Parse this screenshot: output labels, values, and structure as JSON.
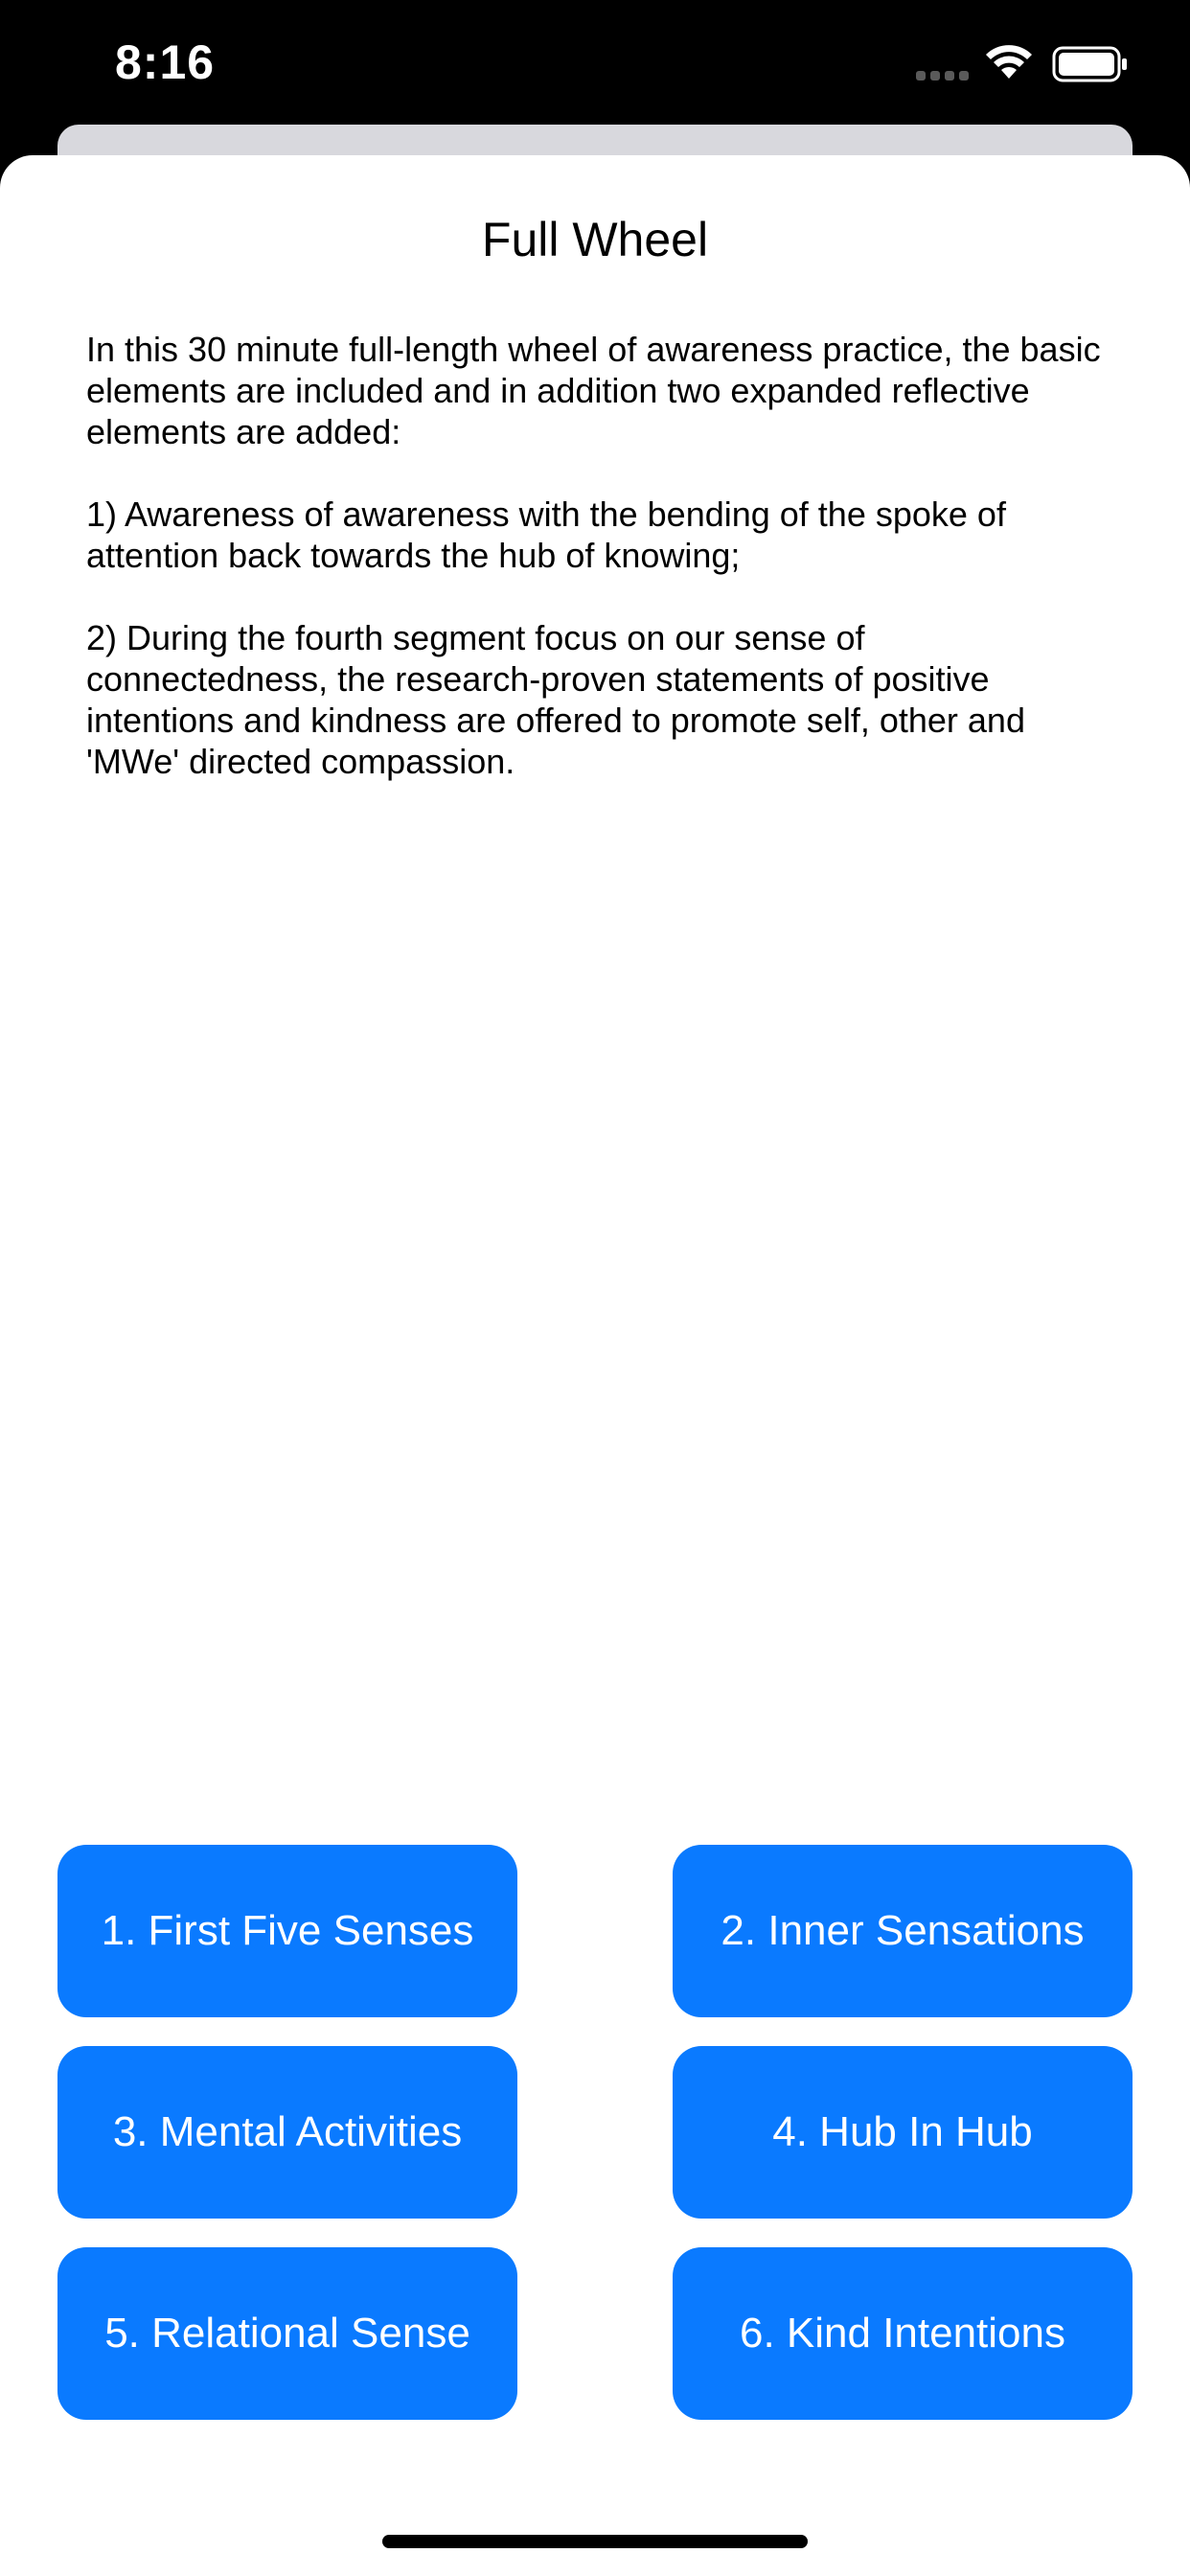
{
  "status_bar": {
    "time": "8:16",
    "icons": [
      "cellular-signal-icon",
      "wifi-icon",
      "battery-icon"
    ]
  },
  "page": {
    "title": "Full Wheel",
    "description": "In this 30 minute full-length wheel of awareness practice, the basic elements are included and in addition two expanded reflective elements are added:\n\n1) Awareness of awareness with the bending of the spoke of attention back towards the hub of knowing;\n\n2) During the fourth segment focus on our sense of connectedness, the research-proven statements of positive intentions and kindness are offered to promote self, other and 'MWe' directed compassion."
  },
  "segments": [
    {
      "label": "1. First Five Senses"
    },
    {
      "label": "2. Inner Sensations"
    },
    {
      "label": "3. Mental Activities"
    },
    {
      "label": "4. Hub In Hub"
    },
    {
      "label": "5. Relational Sense"
    },
    {
      "label": "6. Kind Intentions"
    }
  ],
  "colors": {
    "accent": "#0a7aff",
    "status_bar_bg": "#000000",
    "sheet_bg": "#ffffff",
    "sheet_behind": "#d8d8dd"
  }
}
